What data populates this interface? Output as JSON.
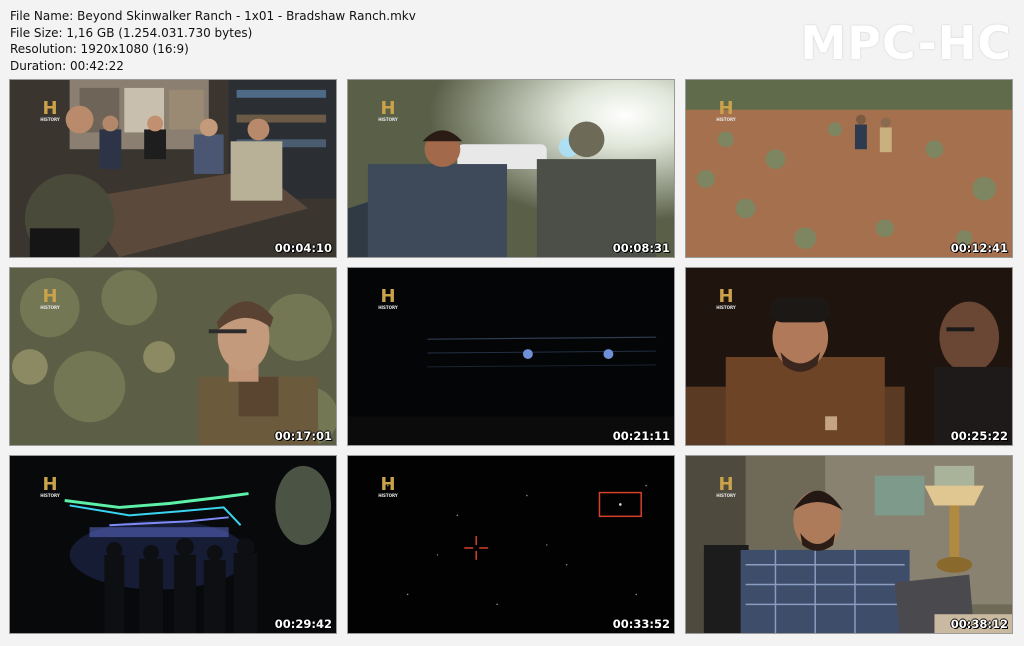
{
  "info": {
    "file_name": "File Name: Beyond Skinwalker Ranch - 1x01 - Bradshaw Ranch.mkv",
    "file_size": "File Size: 1,16 GB (1.254.031.730 bytes)",
    "resolution": "Resolution: 1920x1080 (16:9)",
    "duration": "Duration: 00:42:22"
  },
  "logo": "MPC-HC",
  "channel_logo": {
    "letter": "H",
    "word": "HISTORY",
    "color": "#c9a24a"
  },
  "thumbnails": [
    {
      "timestamp": "00:04:10"
    },
    {
      "timestamp": "00:08:31"
    },
    {
      "timestamp": "00:12:41"
    },
    {
      "timestamp": "00:17:01"
    },
    {
      "timestamp": "00:21:11"
    },
    {
      "timestamp": "00:25:22"
    },
    {
      "timestamp": "00:29:42"
    },
    {
      "timestamp": "00:33:52"
    },
    {
      "timestamp": "00:38:12"
    }
  ]
}
